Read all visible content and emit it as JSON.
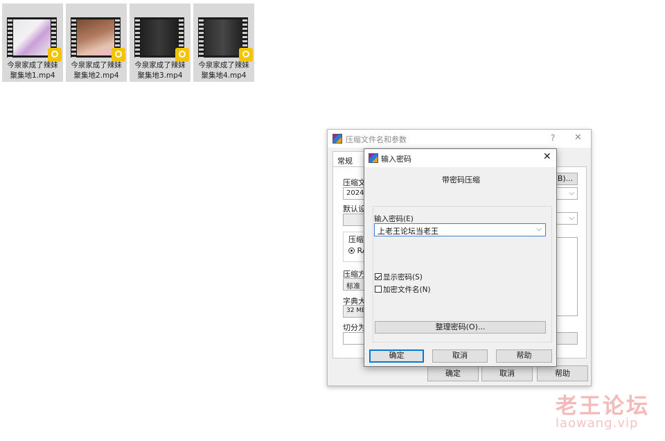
{
  "files": [
    {
      "name": "今泉家成了辣妹\n聚集地1.mp4",
      "thumb": "img1"
    },
    {
      "name": "今泉家成了辣妹\n聚集地2.mp4",
      "thumb": "img2"
    },
    {
      "name": "今泉家成了辣妹\n聚集地3.mp4",
      "thumb": "img3"
    },
    {
      "name": "今泉家成了辣妹\n聚集地4.mp4",
      "thumb": "img4"
    }
  ],
  "archive_dialog": {
    "title": "压缩文件名和参数",
    "help": "?",
    "close": "✕",
    "tab_general": "常规",
    "label_archive_name": "压缩文",
    "archive_name_value": "20242",
    "browse_button": "B)...",
    "label_default_profile": "默认设",
    "label_format": "压缩",
    "format_option": "RA",
    "label_method": "压缩方",
    "method_value": "标准",
    "label_dict": "字典大",
    "dict_value": "32 MB",
    "label_split": "切分为",
    "ok": "确定",
    "cancel": "取消",
    "help_button": "帮助"
  },
  "password_dialog": {
    "title": "输入密码",
    "close": "✕",
    "heading": "带密码压缩",
    "label_enter_password": "输入密码(E)",
    "password_value": "上老王论坛当老王",
    "show_password": "显示密码(S)",
    "show_password_checked": true,
    "encrypt_names": "加密文件名(N)",
    "encrypt_names_checked": false,
    "organize_button": "整理密码(O)...",
    "ok": "确定",
    "cancel": "取消",
    "help": "帮助"
  },
  "watermark": {
    "cn": "老王论坛",
    "url": "laowang.vip"
  }
}
